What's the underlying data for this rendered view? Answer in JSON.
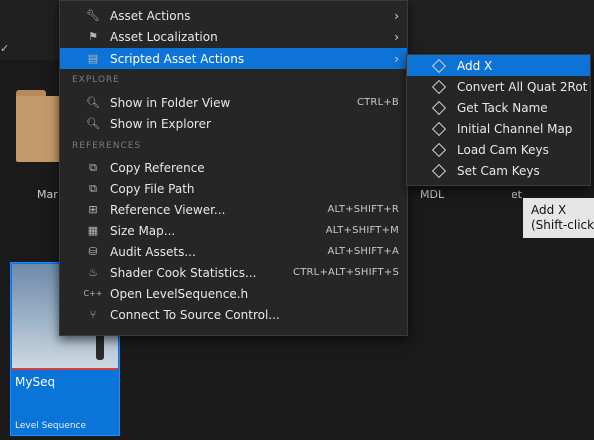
{
  "background": {
    "tiles": [
      {
        "label": "Mar"
      },
      {
        "label": "MDL"
      },
      {
        "label": "mationAsset"
      }
    ],
    "sequence_tile": {
      "name": "MySeq",
      "type": "Level Sequence"
    }
  },
  "menu": {
    "items_top": [
      {
        "label": "Asset Actions",
        "icon": "wrench-icon"
      },
      {
        "label": "Asset Localization",
        "icon": "flag-icon"
      },
      {
        "label": "Scripted Asset Actions",
        "icon": "script-icon"
      }
    ],
    "sections": {
      "explore": "EXPLORE",
      "references": "REFERENCES"
    },
    "explore_items": [
      {
        "label": "Show in Folder View",
        "shortcut": "CTRL+B",
        "icon": "folder-search-icon"
      },
      {
        "label": "Show in Explorer",
        "shortcut": "",
        "icon": "folder-search-icon"
      }
    ],
    "reference_items": [
      {
        "label": "Copy Reference",
        "shortcut": "",
        "icon": "copy-icon"
      },
      {
        "label": "Copy File Path",
        "shortcut": "",
        "icon": "copy-icon"
      },
      {
        "label": "Reference Viewer...",
        "shortcut": "ALT+SHIFT+R",
        "icon": "reference-viewer-icon"
      },
      {
        "label": "Size Map...",
        "shortcut": "ALT+SHIFT+M",
        "icon": "size-map-icon"
      },
      {
        "label": "Audit Assets...",
        "shortcut": "ALT+SHIFT+A",
        "icon": "audit-icon"
      },
      {
        "label": "Shader Cook Statistics...",
        "shortcut": "CTRL+ALT+SHIFT+S",
        "icon": "shader-icon"
      },
      {
        "label": "Open LevelSequence.h",
        "shortcut": "",
        "icon": "cpp-icon"
      },
      {
        "label": "Connect To Source Control...",
        "shortcut": "",
        "icon": "source-control-icon"
      }
    ]
  },
  "submenu": {
    "items": [
      {
        "label": "Add X"
      },
      {
        "label": "Convert All Quat 2Rot"
      },
      {
        "label": "Get Tack Name"
      },
      {
        "label": "Initial Channel Map"
      },
      {
        "label": "Load Cam Keys"
      },
      {
        "label": "Set Cam Keys"
      }
    ]
  },
  "tooltip": {
    "line1": "Add X",
    "line2": "(Shift-click t"
  },
  "colors": {
    "accent": "#0d73d6",
    "menu_bg": "#262626",
    "background": "#1a1a1a"
  }
}
